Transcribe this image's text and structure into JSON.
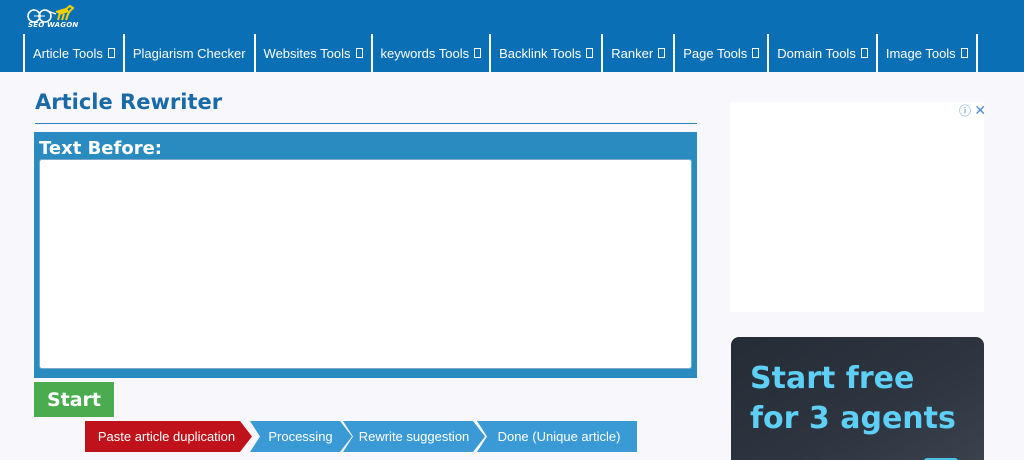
{
  "logo": {
    "text": "SEO WAGON"
  },
  "nav": {
    "items": [
      {
        "label": "Article Tools",
        "dropdown": true
      },
      {
        "label": "Plagiarism Checker",
        "dropdown": false
      },
      {
        "label": "Websites Tools",
        "dropdown": true
      },
      {
        "label": "keywords Tools",
        "dropdown": true
      },
      {
        "label": "Backlink Tools",
        "dropdown": true
      },
      {
        "label": "Ranker",
        "dropdown": true
      },
      {
        "label": "Page Tools",
        "dropdown": true
      },
      {
        "label": "Domain Tools",
        "dropdown": true
      },
      {
        "label": "Image Tools",
        "dropdown": true
      }
    ]
  },
  "page": {
    "title": "Article Rewriter"
  },
  "editor": {
    "label": "Text Before:",
    "value": ""
  },
  "actions": {
    "start_label": "Start"
  },
  "steps": [
    {
      "label": "Paste article duplication",
      "active": true
    },
    {
      "label": "Processing",
      "active": false
    },
    {
      "label": "Rewrite suggestion",
      "active": false
    },
    {
      "label": "Done (Unique article)",
      "active": false
    }
  ],
  "ad": {
    "line1": "Start free",
    "line2": "for 3 agents"
  },
  "colors": {
    "header": "#0a6fb5",
    "panel": "#2a8bc0",
    "start": "#4aac4e",
    "step_active": "#c0121a",
    "step_inactive": "#3a9ad6",
    "ad_text": "#5ed0f5"
  }
}
